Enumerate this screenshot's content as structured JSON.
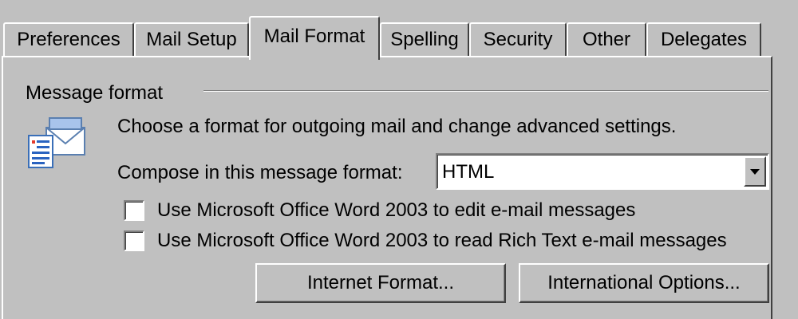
{
  "tabs": [
    {
      "label": "Preferences"
    },
    {
      "label": "Mail Setup"
    },
    {
      "label": "Mail Format",
      "active": true
    },
    {
      "label": "Spelling"
    },
    {
      "label": "Security"
    },
    {
      "label": "Other"
    },
    {
      "label": "Delegates"
    }
  ],
  "message_format": {
    "group_title": "Message format",
    "icon": "message-format-envelope-icon",
    "description": "Choose a format for outgoing mail and change advanced settings.",
    "compose_label": "Compose in this message format:",
    "compose_value": "HTML",
    "checkboxes": [
      {
        "label": "Use Microsoft Office Word 2003 to edit e-mail messages",
        "checked": false
      },
      {
        "label": "Use Microsoft Office Word 2003 to read Rich Text e-mail messages",
        "checked": false
      }
    ],
    "buttons": {
      "internet_format": "Internet Format...",
      "international_options": "International Options..."
    }
  }
}
